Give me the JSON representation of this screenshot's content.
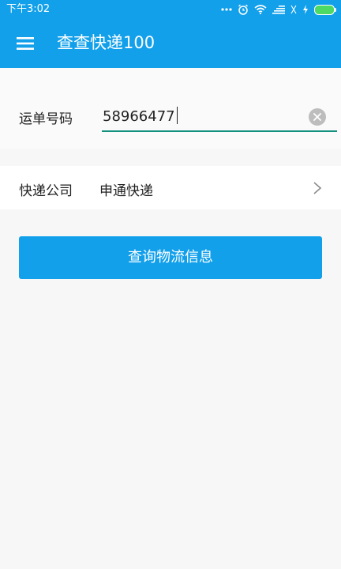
{
  "status_bar": {
    "time": "下午3:02",
    "icons": [
      "more-dots-icon",
      "alarm-icon",
      "wifi-icon",
      "signal-icon",
      "no-sim-icon",
      "charging-icon",
      "battery-icon"
    ],
    "battery_color": "#4cd964"
  },
  "app_bar": {
    "title": "查查快递100",
    "menu_icon": "hamburger-menu-icon",
    "background": "#12a0eb"
  },
  "form": {
    "waybill_label": "运单号码",
    "waybill_value": "58966477",
    "clear_icon": "clear-icon",
    "company_label": "快递公司",
    "company_value": "申通快递",
    "chevron_icon": "chevron-right-icon"
  },
  "actions": {
    "query_label": "查询物流信息"
  },
  "colors": {
    "accent": "#12a0eb",
    "input_underline": "#12907e"
  }
}
